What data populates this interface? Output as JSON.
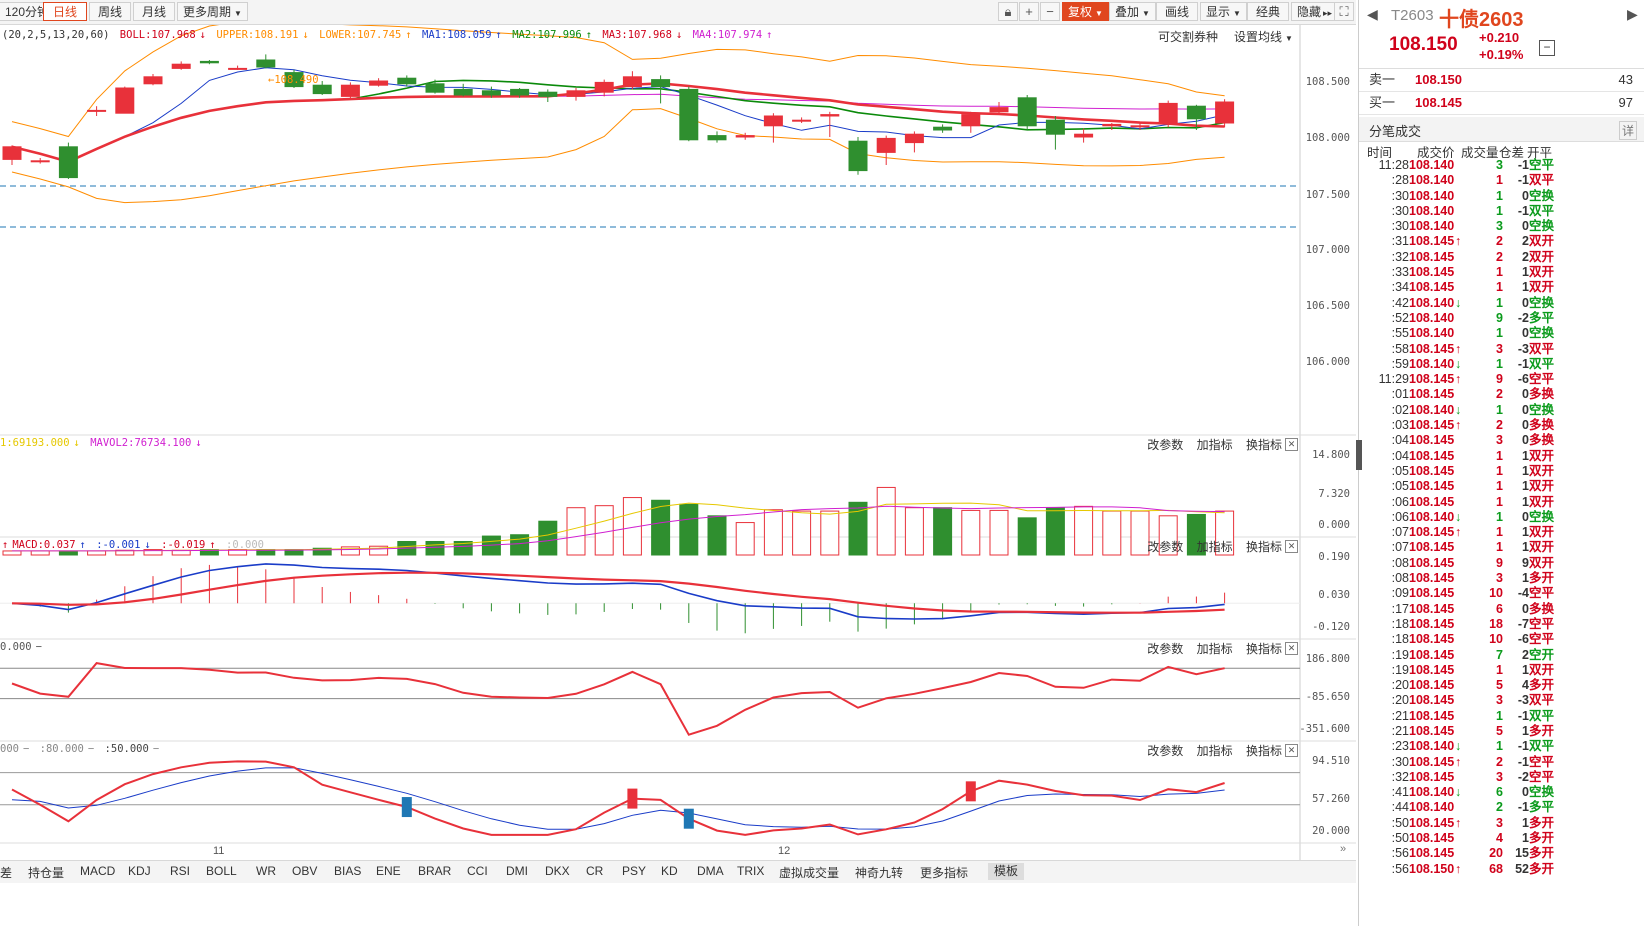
{
  "toolbar": {
    "periods": [
      "120分钟",
      "日线",
      "周线",
      "月线",
      "更多周期"
    ],
    "active_period": "日线",
    "fuquan": "复权",
    "overlay": "叠加",
    "draw": "画线",
    "display": "显示",
    "classic": "经典",
    "hide": "隐藏"
  },
  "main_legend": {
    "params": "(20,2,5,13,20,60)",
    "boll": "BOLL:107.968",
    "upper": "UPPER:108.191",
    "lower": "LOWER:107.745",
    "ma1": "MA1:108.059",
    "ma2": "MA2:107.996",
    "ma3": "MA3:107.968",
    "ma4": "MA4:107.974",
    "switch_label": "可交割券种",
    "ma_setting": "设置均线"
  },
  "main_axis": [
    "108.500",
    "108.000",
    "107.500",
    "107.000",
    "106.500",
    "106.000"
  ],
  "high_marker": "108.490",
  "vol_legend": {
    "vol": "1:69193.000",
    "mavol2": "MAVOL2:76734.100"
  },
  "vol_axis": [
    "14.800",
    "7.320",
    "0.000"
  ],
  "macd_legend": {
    "macd": "MACD:0.037",
    "dif": ":-0.001",
    "dea": ":-0.019",
    "zero": ":0.000"
  },
  "macd_axis": [
    "0.190",
    "0.030",
    "-0.120"
  ],
  "cci_legend": "0.000",
  "cci_axis": [
    "186.800",
    "-85.650",
    "-351.600"
  ],
  "kdj_legend": {
    "a": "000",
    "b": ":80.000",
    "c": ":50.000"
  },
  "kdj_axis": [
    "94.510",
    "57.260",
    "20.000"
  ],
  "panel_controls": [
    "改参数",
    "加指标",
    "换指标"
  ],
  "x_labels": [
    "11",
    "12"
  ],
  "bottom_tabs": [
    "差",
    "持仓量",
    "MACD",
    "KDJ",
    "RSI",
    "BOLL",
    "WR",
    "OBV",
    "BIAS",
    "ENE",
    "BRAR",
    "CCI",
    "DMI",
    "DKX",
    "CR",
    "PSY",
    "KD",
    "DMA",
    "TRIX",
    "虚拟成交量",
    "神奇九转",
    "更多指标",
    "模板"
  ],
  "bottom_selected": "模板",
  "colors": {
    "up": "#e8313a",
    "down": "#2f8f2f",
    "accent": "#e0461e"
  },
  "quote": {
    "code": "T2603",
    "name": "十债2603",
    "price": "108.150",
    "change": "+0.210",
    "change_pct": "+0.19%",
    "sell_label": "卖一",
    "sell_price": "108.150",
    "sell_vol": "43",
    "buy_label": "买一",
    "buy_price": "108.145",
    "buy_vol": "97",
    "ticks_title": "分笔成交",
    "detail_btn": "详",
    "cols": [
      "时间",
      "成交价",
      "成交量",
      "仓差",
      "开平"
    ]
  },
  "ticks": [
    {
      "t": "11:28",
      "p": "108.140",
      "a": "",
      "v": "3",
      "oi": "-1",
      "ty": "空平",
      "c": "green"
    },
    {
      "t": ":28",
      "p": "108.140",
      "a": "",
      "v": "1",
      "oi": "-1",
      "ty": "双平",
      "c": "red"
    },
    {
      "t": ":30",
      "p": "108.140",
      "a": "",
      "v": "1",
      "oi": "0",
      "ty": "空换",
      "c": "green"
    },
    {
      "t": ":30",
      "p": "108.140",
      "a": "",
      "v": "1",
      "oi": "-1",
      "ty": "双平",
      "c": "green"
    },
    {
      "t": ":30",
      "p": "108.140",
      "a": "",
      "v": "3",
      "oi": "0",
      "ty": "空换",
      "c": "green"
    },
    {
      "t": ":31",
      "p": "108.145",
      "a": "↑",
      "v": "2",
      "oi": "2",
      "ty": "双开",
      "c": "red"
    },
    {
      "t": ":32",
      "p": "108.145",
      "a": "",
      "v": "2",
      "oi": "2",
      "ty": "双开",
      "c": "red"
    },
    {
      "t": ":33",
      "p": "108.145",
      "a": "",
      "v": "1",
      "oi": "1",
      "ty": "双开",
      "c": "red"
    },
    {
      "t": ":34",
      "p": "108.145",
      "a": "",
      "v": "1",
      "oi": "1",
      "ty": "双开",
      "c": "red"
    },
    {
      "t": ":42",
      "p": "108.140",
      "a": "↓",
      "v": "1",
      "oi": "0",
      "ty": "空换",
      "c": "green"
    },
    {
      "t": ":52",
      "p": "108.140",
      "a": "",
      "v": "9",
      "oi": "-2",
      "ty": "多平",
      "c": "green"
    },
    {
      "t": ":55",
      "p": "108.140",
      "a": "",
      "v": "1",
      "oi": "0",
      "ty": "空换",
      "c": "green"
    },
    {
      "t": ":58",
      "p": "108.145",
      "a": "↑",
      "v": "3",
      "oi": "-3",
      "ty": "双平",
      "c": "red"
    },
    {
      "t": ":59",
      "p": "108.140",
      "a": "↓",
      "v": "1",
      "oi": "-1",
      "ty": "双平",
      "c": "green"
    },
    {
      "t": "11:29",
      "p": "108.145",
      "a": "↑",
      "v": "9",
      "oi": "-6",
      "ty": "空平",
      "c": "red"
    },
    {
      "t": ":01",
      "p": "108.145",
      "a": "",
      "v": "2",
      "oi": "0",
      "ty": "多换",
      "c": "red"
    },
    {
      "t": ":02",
      "p": "108.140",
      "a": "↓",
      "v": "1",
      "oi": "0",
      "ty": "空换",
      "c": "green"
    },
    {
      "t": ":03",
      "p": "108.145",
      "a": "↑",
      "v": "2",
      "oi": "0",
      "ty": "多换",
      "c": "red"
    },
    {
      "t": ":04",
      "p": "108.145",
      "a": "",
      "v": "3",
      "oi": "0",
      "ty": "多换",
      "c": "red"
    },
    {
      "t": ":04",
      "p": "108.145",
      "a": "",
      "v": "1",
      "oi": "1",
      "ty": "双开",
      "c": "red"
    },
    {
      "t": ":05",
      "p": "108.145",
      "a": "",
      "v": "1",
      "oi": "1",
      "ty": "双开",
      "c": "red"
    },
    {
      "t": ":05",
      "p": "108.145",
      "a": "",
      "v": "1",
      "oi": "1",
      "ty": "双开",
      "c": "red"
    },
    {
      "t": ":06",
      "p": "108.145",
      "a": "",
      "v": "1",
      "oi": "1",
      "ty": "双开",
      "c": "red"
    },
    {
      "t": ":06",
      "p": "108.140",
      "a": "↓",
      "v": "1",
      "oi": "0",
      "ty": "空换",
      "c": "green"
    },
    {
      "t": ":07",
      "p": "108.145",
      "a": "↑",
      "v": "1",
      "oi": "1",
      "ty": "双开",
      "c": "red"
    },
    {
      "t": ":07",
      "p": "108.145",
      "a": "",
      "v": "1",
      "oi": "1",
      "ty": "双开",
      "c": "red"
    },
    {
      "t": ":08",
      "p": "108.145",
      "a": "",
      "v": "9",
      "oi": "9",
      "ty": "双开",
      "c": "red"
    },
    {
      "t": ":08",
      "p": "108.145",
      "a": "",
      "v": "3",
      "oi": "1",
      "ty": "多开",
      "c": "red"
    },
    {
      "t": ":09",
      "p": "108.145",
      "a": "",
      "v": "10",
      "oi": "-4",
      "ty": "空平",
      "c": "red"
    },
    {
      "t": ":17",
      "p": "108.145",
      "a": "",
      "v": "6",
      "oi": "0",
      "ty": "多换",
      "c": "red"
    },
    {
      "t": ":18",
      "p": "108.145",
      "a": "",
      "v": "18",
      "oi": "-7",
      "ty": "空平",
      "c": "red"
    },
    {
      "t": ":18",
      "p": "108.145",
      "a": "",
      "v": "10",
      "oi": "-6",
      "ty": "空平",
      "c": "red"
    },
    {
      "t": ":19",
      "p": "108.145",
      "a": "",
      "v": "7",
      "oi": "2",
      "ty": "空开",
      "c": "green"
    },
    {
      "t": ":19",
      "p": "108.145",
      "a": "",
      "v": "1",
      "oi": "1",
      "ty": "双开",
      "c": "red"
    },
    {
      "t": ":20",
      "p": "108.145",
      "a": "",
      "v": "5",
      "oi": "4",
      "ty": "多开",
      "c": "red"
    },
    {
      "t": ":20",
      "p": "108.145",
      "a": "",
      "v": "3",
      "oi": "-3",
      "ty": "双平",
      "c": "red"
    },
    {
      "t": ":21",
      "p": "108.145",
      "a": "",
      "v": "1",
      "oi": "-1",
      "ty": "双平",
      "c": "green"
    },
    {
      "t": ":21",
      "p": "108.145",
      "a": "",
      "v": "5",
      "oi": "1",
      "ty": "多开",
      "c": "red"
    },
    {
      "t": ":23",
      "p": "108.140",
      "a": "↓",
      "v": "1",
      "oi": "-1",
      "ty": "双平",
      "c": "green"
    },
    {
      "t": ":30",
      "p": "108.145",
      "a": "↑",
      "v": "2",
      "oi": "-1",
      "ty": "空平",
      "c": "red"
    },
    {
      "t": ":32",
      "p": "108.145",
      "a": "",
      "v": "3",
      "oi": "-2",
      "ty": "空平",
      "c": "red"
    },
    {
      "t": ":41",
      "p": "108.140",
      "a": "↓",
      "v": "6",
      "oi": "0",
      "ty": "空换",
      "c": "green"
    },
    {
      "t": ":44",
      "p": "108.140",
      "a": "",
      "v": "2",
      "oi": "-1",
      "ty": "多平",
      "c": "green"
    },
    {
      "t": ":50",
      "p": "108.145",
      "a": "↑",
      "v": "3",
      "oi": "1",
      "ty": "多开",
      "c": "red"
    },
    {
      "t": ":50",
      "p": "108.145",
      "a": "",
      "v": "4",
      "oi": "1",
      "ty": "多开",
      "c": "red"
    },
    {
      "t": ":56",
      "p": "108.145",
      "a": "",
      "v": "20",
      "oi": "15",
      "ty": "多开",
      "c": "red"
    },
    {
      "t": ":56",
      "p": "108.150",
      "a": "↑",
      "v": "68",
      "oi": "52",
      "ty": "多开",
      "c": "red"
    }
  ],
  "chart_data": {
    "type": "candlestick",
    "ohlc": [
      [
        107.74,
        107.83,
        107.7,
        107.84
      ],
      [
        107.73,
        107.73,
        107.71,
        107.75
      ],
      [
        107.83,
        107.61,
        107.6,
        107.86
      ],
      [
        108.09,
        108.09,
        108.05,
        108.12
      ],
      [
        108.07,
        108.25,
        108.07,
        108.26
      ],
      [
        108.28,
        108.33,
        108.27,
        108.35
      ],
      [
        108.39,
        108.42,
        108.38,
        108.44
      ],
      [
        108.44,
        108.43,
        108.42,
        108.45
      ],
      [
        108.39,
        108.39,
        108.38,
        108.41
      ],
      [
        108.45,
        108.4,
        108.39,
        108.49
      ],
      [
        108.36,
        108.26,
        108.25,
        108.38
      ],
      [
        108.27,
        108.21,
        108.2,
        108.3
      ],
      [
        108.19,
        108.27,
        108.17,
        108.29
      ],
      [
        108.27,
        108.3,
        108.26,
        108.32
      ],
      [
        108.32,
        108.28,
        108.26,
        108.34
      ],
      [
        108.28,
        108.22,
        108.21,
        108.31
      ],
      [
        108.24,
        108.2,
        108.19,
        108.28
      ],
      [
        108.23,
        108.2,
        108.18,
        108.26
      ],
      [
        108.24,
        108.2,
        108.18,
        108.25
      ],
      [
        108.22,
        108.19,
        108.15,
        108.24
      ],
      [
        108.19,
        108.23,
        108.16,
        108.25
      ],
      [
        108.22,
        108.29,
        108.19,
        108.31
      ],
      [
        108.26,
        108.33,
        108.24,
        108.37
      ],
      [
        108.31,
        108.26,
        108.14,
        108.34
      ],
      [
        108.24,
        107.88,
        107.87,
        108.26
      ],
      [
        107.91,
        107.88,
        107.86,
        107.94
      ],
      [
        107.9,
        107.91,
        107.88,
        107.93
      ],
      [
        107.98,
        108.05,
        107.86,
        108.07
      ],
      [
        108.02,
        108.02,
        108.0,
        108.04
      ],
      [
        108.05,
        108.06,
        107.9,
        108.08
      ],
      [
        107.87,
        107.66,
        107.63,
        107.9
      ],
      [
        107.79,
        107.89,
        107.7,
        107.91
      ],
      [
        107.86,
        107.92,
        107.79,
        107.94
      ],
      [
        107.97,
        107.95,
        107.93,
        107.99
      ],
      [
        107.98,
        108.06,
        107.93,
        108.08
      ],
      [
        108.08,
        108.11,
        108.06,
        108.15
      ],
      [
        108.18,
        107.98,
        107.95,
        108.2
      ],
      [
        108.02,
        107.92,
        107.81,
        108.05
      ],
      [
        107.9,
        107.92,
        107.86,
        107.96
      ],
      [
        107.98,
        107.99,
        107.95,
        108.0
      ],
      [
        107.98,
        107.98,
        107.95,
        108.0
      ],
      [
        108.0,
        108.14,
        107.97,
        108.16
      ],
      [
        108.12,
        108.03,
        107.95,
        108.13
      ],
      [
        108.0,
        108.15,
        107.97,
        108.17
      ]
    ],
    "volume": [
      0.6,
      0.6,
      0.6,
      0.6,
      0.7,
      0.8,
      0.7,
      0.8,
      0.8,
      0.8,
      0.8,
      1.0,
      1.2,
      1.3,
      2.0,
      2.0,
      2.0,
      2.8,
      3.0,
      5.0,
      7.0,
      7.3,
      8.5,
      8.1,
      7.5,
      5.8,
      4.8,
      6.7,
      6.5,
      6.5,
      7.8,
      10.0,
      7.0,
      7.0,
      6.6,
      6.6,
      5.5,
      7.0,
      7.2,
      6.5,
      6.5,
      5.8,
      6.0,
      6.5
    ],
    "ylim": [
      105.7,
      108.7
    ],
    "volume_ylim": [
      0,
      14.8
    ],
    "macd_ylim": [
      -0.12,
      0.19
    ],
    "cci_ylim": [
      -351.6,
      186.8
    ],
    "kdj_ylim": [
      20,
      94.51
    ]
  }
}
